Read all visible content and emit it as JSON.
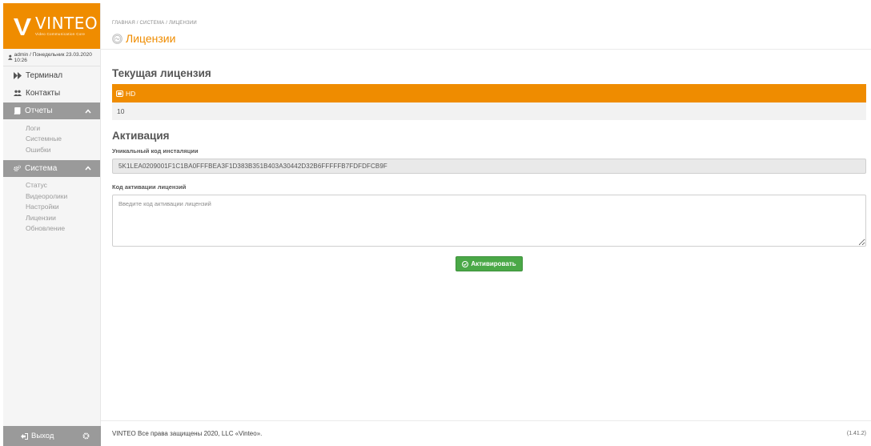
{
  "sidebar": {
    "logo": {
      "word": "VINTEO",
      "subtitle": "Video Communication Core"
    },
    "user_line": "admin / Понедельник 23.03.2020 10:26",
    "items": [
      {
        "label": "Терминал",
        "icon": "forward-icon"
      },
      {
        "label": "Контакты",
        "icon": "users-icon"
      }
    ],
    "sections": [
      {
        "label": "Отчеты",
        "icon": "book-icon",
        "expanded": true,
        "items": [
          "Логи",
          "Системные",
          "Ошибки"
        ]
      },
      {
        "label": "Система",
        "icon": "gears-icon",
        "expanded": true,
        "items": [
          "Статус",
          "Видеоролики",
          "Настройки",
          "Лицензии",
          "Обновление"
        ]
      }
    ],
    "footer": {
      "logout_label": "Выход"
    }
  },
  "header": {
    "breadcrumb": "ГЛАВНАЯ / СИСТЕМА / ЛИЦЕНЗИИ",
    "title": "Лицензии"
  },
  "license": {
    "heading": "Текущая лицензия",
    "type": "HD",
    "value": "10"
  },
  "activation": {
    "heading": "Активация",
    "install_code_label": "Уникальный код инсталяции",
    "install_code": "5K1LEA0209001F1C1BA0FFFBEA3F1D383B351B403A30442D32B6FFFFFB7FDFDFCB9F",
    "key_label": "Код активации лицензий",
    "key_placeholder": "Введите код активации лицензий",
    "key_value": "",
    "activate_button": "Активировать"
  },
  "footer": {
    "copyright": "VINTEO   Все права защищены 2020, LLC «Vinteo».",
    "version": "(1.41.2)"
  },
  "colors": {
    "brand": "#ef8c00",
    "sidebar_section": "#9a9a9a",
    "success": "#4aa847"
  }
}
